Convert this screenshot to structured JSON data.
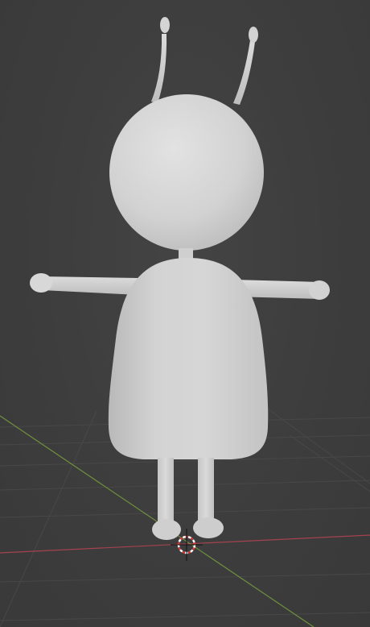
{
  "viewport": {
    "background_color": "#3d3d3d",
    "grid_color": "#4a4a4a",
    "x_axis_color": "#a3434f",
    "y_axis_color": "#6f8f3e",
    "grid_visible": true
  },
  "scene": {
    "objects": [
      {
        "name": "character-body-mesh",
        "color": "#cfcfcf"
      },
      {
        "name": "character-head-mesh",
        "color": "#d6d6d6"
      },
      {
        "name": "antenna-left"
      },
      {
        "name": "antenna-right"
      },
      {
        "name": "arm-left"
      },
      {
        "name": "arm-right"
      },
      {
        "name": "leg-left"
      },
      {
        "name": "leg-right"
      }
    ]
  },
  "cursor_3d": {
    "colors": [
      "#ffffff",
      "#d63a3a"
    ]
  }
}
